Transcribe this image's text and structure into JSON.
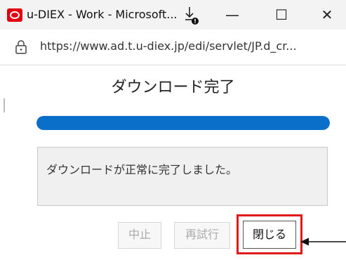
{
  "window": {
    "title": "u-DIEX - Work - Microsoft...",
    "minimize_glyph": "—",
    "maximize_glyph": "☐",
    "close_glyph": "✕",
    "icons": [
      "app-logo-icon",
      "download-icon",
      "lock-icon",
      "arrow-icon"
    ]
  },
  "address_bar": {
    "url": "https://www.ad.t.u-diex.jp/edi/servlet/JP.d_cr..."
  },
  "dialog": {
    "title": "ダウンロード完了",
    "progress": 1.0,
    "message": "ダウンロードが正常に完了しました。",
    "buttons": {
      "abort": "中止",
      "retry": "再試行",
      "close": "閉じる"
    }
  },
  "colors": {
    "progress_fill": "#0a6fc9",
    "highlight_frame": "#e01919"
  }
}
